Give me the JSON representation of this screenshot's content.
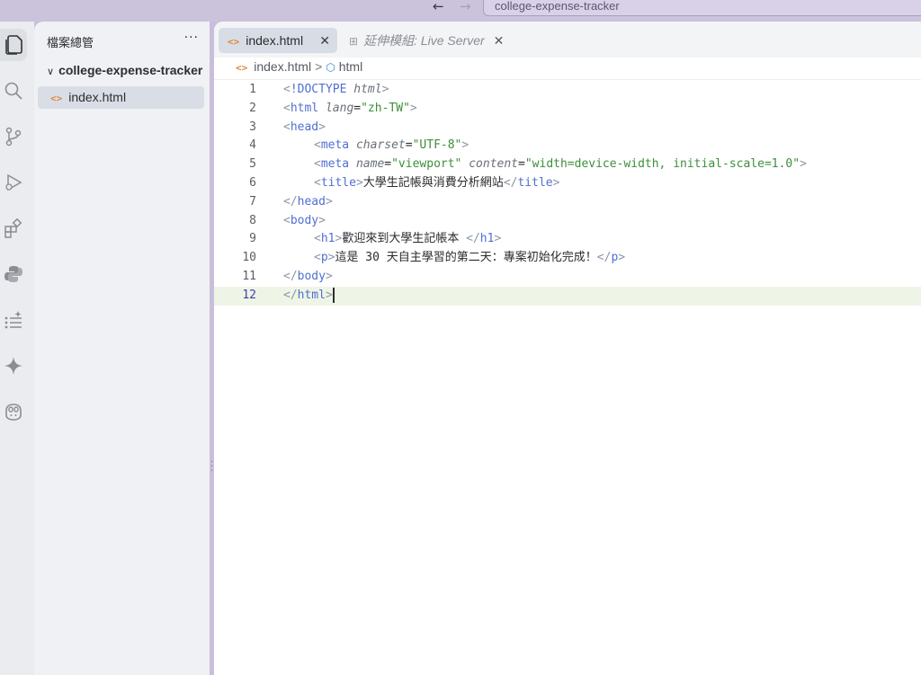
{
  "titlebar": {
    "back_icon": "arrow-left-icon",
    "forward_icon": "arrow-right-icon",
    "search_text": "college-expense-tracker"
  },
  "activity_bar": {
    "items": [
      {
        "name": "explorer-icon",
        "active": true
      },
      {
        "name": "search-icon"
      },
      {
        "name": "source-control-icon"
      },
      {
        "name": "run-debug-icon"
      },
      {
        "name": "extensions-icon"
      },
      {
        "name": "python-icon"
      },
      {
        "name": "testing-icon"
      },
      {
        "name": "sparkle-icon"
      },
      {
        "name": "copilot-icon"
      }
    ]
  },
  "sidebar": {
    "title": "檔案總管",
    "more": "···",
    "folder": "college-expense-tracker",
    "file": "index.html",
    "file_icon": "<>"
  },
  "tabs": [
    {
      "label": "index.html",
      "active": true,
      "icon": "<>",
      "close": "✕"
    },
    {
      "label": "延伸模組: Live Server",
      "active": false,
      "close": "✕"
    }
  ],
  "breadcrumb": {
    "file": "index.html",
    "separator": ">",
    "element": "html"
  },
  "editor": {
    "current_line": 12,
    "lines": [
      {
        "n": "1"
      },
      {
        "n": "2"
      },
      {
        "n": "3"
      },
      {
        "n": "4"
      },
      {
        "n": "5"
      },
      {
        "n": "6"
      },
      {
        "n": "7"
      },
      {
        "n": "8"
      },
      {
        "n": "9"
      },
      {
        "n": "10"
      },
      {
        "n": "11"
      },
      {
        "n": "12"
      }
    ],
    "tokens": {
      "doctype_kw": "!DOCTYPE",
      "doctype_val": "html",
      "html": "html",
      "lang_attr": "lang",
      "lang_val": "\"zh-TW\"",
      "head": "head",
      "meta": "meta",
      "charset_attr": "charset",
      "charset_val": "\"UTF-8\"",
      "name_attr": "name",
      "name_val": "\"viewport\"",
      "content_attr": "content",
      "content_val": "\"width=device-width, initial-scale=1.0\"",
      "title": "title",
      "title_text": "大學生記帳與消費分析網站",
      "body": "body",
      "h1": "h1",
      "h1_text": "歡迎來到大學生記帳本 ",
      "p": "p",
      "p_text": "這是 30 天自主學習的第二天：專案初始化完成！"
    }
  }
}
